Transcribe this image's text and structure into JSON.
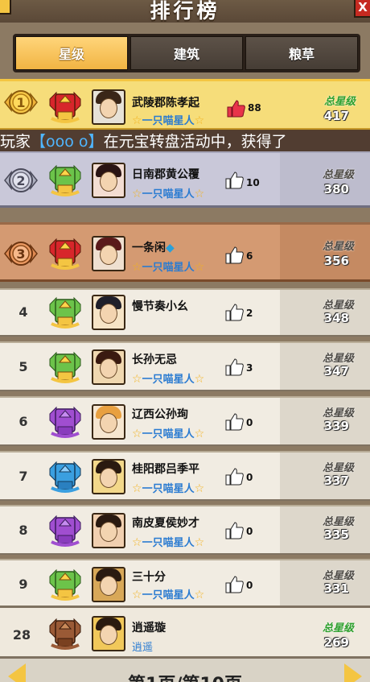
{
  "header": {
    "title": "排行榜",
    "close_label": "X"
  },
  "tabs": [
    {
      "label": "星级",
      "active": true
    },
    {
      "label": "建筑",
      "active": false
    },
    {
      "label": "粮草",
      "active": false
    }
  ],
  "marquee": {
    "prefix": "玩家",
    "player": "【ooo o】",
    "suffix": "在元宝转盘活动中，获得了"
  },
  "score_label": "总星级",
  "rows": [
    {
      "rank": "1",
      "name": "武陵郡陈孝起",
      "sub": "一只喵星人",
      "likes": "88",
      "score": "417"
    },
    {
      "rank": "2",
      "name": "日南郡黄公覆",
      "sub": "一只喵星人",
      "likes": "10",
      "score": "380"
    },
    {
      "rank": "3",
      "name": "一条闲",
      "sub": "一只喵星人",
      "likes": "6",
      "score": "356"
    },
    {
      "rank": "4",
      "name": "慢节奏小幺",
      "sub": "",
      "likes": "2",
      "score": "348"
    },
    {
      "rank": "5",
      "name": "长孙无忌",
      "sub": "一只喵星人",
      "likes": "3",
      "score": "347"
    },
    {
      "rank": "6",
      "name": "辽西公孙珣",
      "sub": "一只喵星人",
      "likes": "0",
      "score": "339"
    },
    {
      "rank": "7",
      "name": "桂阳郡吕季平",
      "sub": "一只喵星人",
      "likes": "0",
      "score": "337"
    },
    {
      "rank": "8",
      "name": "南皮夏侯妙才",
      "sub": "一只喵星人",
      "likes": "0",
      "score": "335"
    },
    {
      "rank": "9",
      "name": "三十分",
      "sub": "一只喵星人",
      "likes": "0",
      "score": "331"
    },
    {
      "rank": "28",
      "name": "逍遥璇",
      "sub": "逍遥",
      "likes": "",
      "score": "269"
    }
  ],
  "colors": {
    "row_gold": "#f6dd7a",
    "row_silver": "#c9c8d9",
    "row_bronze": "#d49a72",
    "row_self": "#efe9dd",
    "accent_gold": "#f4c542"
  },
  "bottom_text": "第1页/第10页"
}
